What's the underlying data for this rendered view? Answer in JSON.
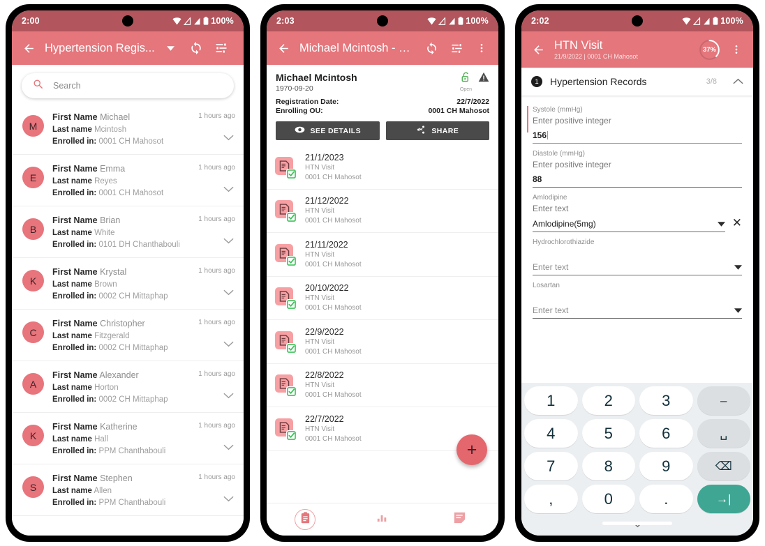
{
  "phone1": {
    "status": {
      "time": "2:00",
      "battery": "100%"
    },
    "appbar": {
      "title": "Hypertension Regis...",
      "back_icon": "back-arrow-icon",
      "dropdown_icon": "caret-down-icon",
      "sync_icon": "sync-icon",
      "filter_icon": "filter-list-icon"
    },
    "search": {
      "placeholder": "Search",
      "icon": "search-icon"
    },
    "labels": {
      "first_name": "First Name",
      "last_name": "Last name",
      "enrolled_in": "Enrolled in:"
    },
    "items": [
      {
        "initial": "M",
        "first_name": "Michael",
        "last_name": "Mcintosh",
        "enrolled_in": "0001 CH Mahosot",
        "time": "1 hours ago"
      },
      {
        "initial": "E",
        "first_name": "Emma",
        "last_name": "Reyes",
        "enrolled_in": "0001 CH Mahosot",
        "time": "1 hours ago"
      },
      {
        "initial": "B",
        "first_name": "Brian",
        "last_name": "White",
        "enrolled_in": "0101 DH Chanthabouli",
        "time": "1 hours ago"
      },
      {
        "initial": "K",
        "first_name": "Krystal",
        "last_name": "Brown",
        "enrolled_in": "0002 CH Mittaphap",
        "time": "1 hours ago"
      },
      {
        "initial": "C",
        "first_name": "Christopher",
        "last_name": "Fitzgerald",
        "enrolled_in": "0002 CH Mittaphap",
        "time": "1 hours ago"
      },
      {
        "initial": "A",
        "first_name": "Alexander",
        "last_name": "Horton",
        "enrolled_in": "0002 CH Mittaphap",
        "time": "1 hours ago"
      },
      {
        "initial": "K",
        "first_name": "Katherine",
        "last_name": "Hall",
        "enrolled_in": "PPM Chanthabouli",
        "time": "1 hours ago"
      },
      {
        "initial": "S",
        "first_name": "Stephen",
        "last_name": "Allen",
        "enrolled_in": "PPM Chanthabouli",
        "time": "1 hours ago"
      }
    ]
  },
  "phone2": {
    "status": {
      "time": "2:03",
      "battery": "100%"
    },
    "appbar": {
      "title": "Michael Mcintosh - H...",
      "back_icon": "back-arrow-icon",
      "sync_icon": "sync-icon",
      "filter_icon": "filter-list-icon",
      "overflow_icon": "more-vertical-icon"
    },
    "header": {
      "name": "Michael Mcintosh",
      "dob": "1970-09-20",
      "lock_status": "Open",
      "lock_icon": "lock-open-icon",
      "warning_icon": "warning-triangle-icon",
      "registration_date_label": "Registration Date:",
      "registration_date_value": "22/7/2022",
      "enrolling_ou_label": "Enrolling OU:",
      "enrolling_ou_value": "0001 CH Mahosot",
      "see_details_label": "SEE DETAILS",
      "see_details_icon": "eye-icon",
      "share_label": "SHARE",
      "share_icon": "share-icon"
    },
    "events": [
      {
        "date": "21/1/2023",
        "program": "HTN Visit",
        "org_unit": "0001 CH Mahosot"
      },
      {
        "date": "21/12/2022",
        "program": "HTN Visit",
        "org_unit": "0001 CH Mahosot"
      },
      {
        "date": "21/11/2022",
        "program": "HTN Visit",
        "org_unit": "0001 CH Mahosot"
      },
      {
        "date": "20/10/2022",
        "program": "HTN Visit",
        "org_unit": "0001 CH Mahosot"
      },
      {
        "date": "22/9/2022",
        "program": "HTN Visit",
        "org_unit": "0001 CH Mahosot"
      },
      {
        "date": "22/8/2022",
        "program": "HTN Visit",
        "org_unit": "0001 CH Mahosot"
      },
      {
        "date": "22/7/2022",
        "program": "HTN Visit",
        "org_unit": "0001 CH Mahosot"
      }
    ],
    "fab": {
      "label": "+",
      "icon": "plus-icon"
    },
    "bottom_nav": [
      {
        "icon": "clipboard-icon",
        "active": true
      },
      {
        "icon": "bar-chart-icon",
        "active": false
      },
      {
        "icon": "note-edit-icon",
        "active": false
      }
    ]
  },
  "phone3": {
    "status": {
      "time": "2:02",
      "battery": "100%"
    },
    "appbar": {
      "title": "HTN Visit",
      "subtitle": "21/9/2022 | 0001 CH Mahosot",
      "back_icon": "back-arrow-icon",
      "overflow_icon": "more-vertical-icon",
      "progress_percent": "37%",
      "progress_value": 37
    },
    "section": {
      "number": "1",
      "title": "Hypertension Records",
      "count": "3/8",
      "collapse_icon": "chevron-up-icon"
    },
    "fields": [
      {
        "label": "Systole (mmHg)",
        "hint": "Enter positive integer",
        "value": "156",
        "type": "number",
        "focused": true
      },
      {
        "label": "Diastole (mmHg)",
        "hint": "Enter positive integer",
        "value": "88",
        "type": "number",
        "focused": false
      },
      {
        "label": "Amlodipine",
        "hint": "Enter text",
        "value": "Amlodipine(5mg)",
        "type": "select",
        "focused": false,
        "clearable": true
      },
      {
        "label": "Hydrochlorothiazide",
        "hint": "",
        "value": "Enter text",
        "type": "select",
        "focused": false,
        "placeholder": true
      },
      {
        "label": "Losartan",
        "hint": "",
        "value": "Enter text",
        "type": "select",
        "focused": false,
        "placeholder": true
      }
    ],
    "keyboard": {
      "rows": [
        [
          {
            "label": "1",
            "kind": "num"
          },
          {
            "label": "2",
            "kind": "num"
          },
          {
            "label": "3",
            "kind": "num"
          },
          {
            "label": "–",
            "kind": "func",
            "name": "minus-key"
          }
        ],
        [
          {
            "label": "4",
            "kind": "num"
          },
          {
            "label": "5",
            "kind": "num"
          },
          {
            "label": "6",
            "kind": "num"
          },
          {
            "label": "␣",
            "kind": "func",
            "name": "space-key"
          }
        ],
        [
          {
            "label": "7",
            "kind": "num"
          },
          {
            "label": "8",
            "kind": "num"
          },
          {
            "label": "9",
            "kind": "num"
          },
          {
            "label": "⌫",
            "kind": "func",
            "name": "backspace-key"
          }
        ],
        [
          {
            "label": ",",
            "kind": "num"
          },
          {
            "label": "0",
            "kind": "num"
          },
          {
            "label": ".",
            "kind": "num"
          },
          {
            "label": "→|",
            "kind": "enter",
            "name": "next-key"
          }
        ]
      ],
      "hide_icon": "chevron-down-icon"
    }
  },
  "colors": {
    "status_bar": "#b2555c",
    "app_bar": "#e4767c",
    "accent": "#e4767c",
    "avatar": "#e8747c",
    "fab": "#e4676e",
    "enter_key": "#3fa694",
    "event_icon": "#f7a0a3",
    "check_green": "#3ec25a",
    "lock_green": "#4caf50"
  }
}
